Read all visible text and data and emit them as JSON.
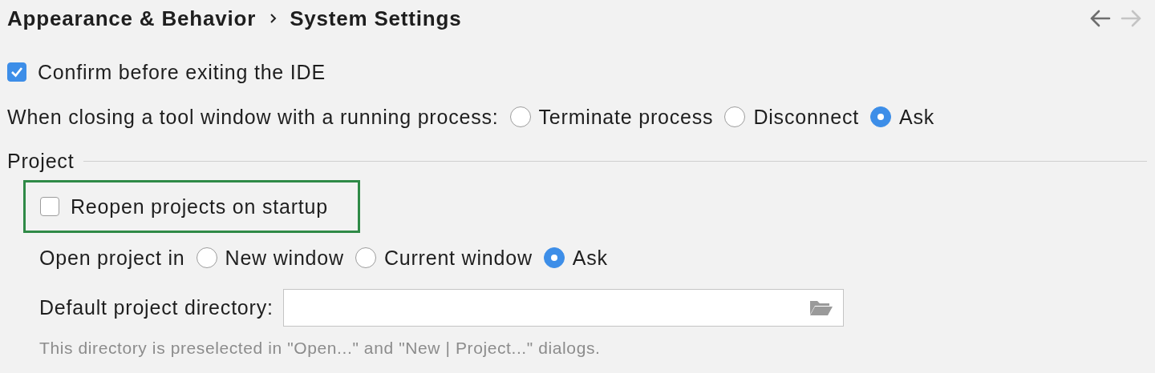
{
  "breadcrumb": [
    {
      "label": "Appearance & Behavior"
    },
    {
      "label": "System Settings"
    }
  ],
  "navigation": [
    {
      "kind": "back",
      "disabled": false
    },
    {
      "kind": "forward",
      "disabled": true
    }
  ],
  "confirm_exit": {
    "label": "Confirm before exiting the IDE",
    "checked": true
  },
  "closing_tool_window": {
    "label": "When closing a tool window with a running process:",
    "options": [
      {
        "label": "Terminate process",
        "selected": false
      },
      {
        "label": "Disconnect",
        "selected": false
      },
      {
        "label": "Ask",
        "selected": true
      }
    ]
  },
  "project": {
    "title": "Project",
    "reopen": {
      "label": "Reopen projects on startup",
      "checked": false,
      "highlighted": true
    },
    "open_in": {
      "label": "Open project in",
      "options": [
        {
          "label": "New window",
          "selected": false
        },
        {
          "label": "Current window",
          "selected": false
        },
        {
          "label": "Ask",
          "selected": true
        }
      ]
    },
    "directory": {
      "label": "Default project directory:",
      "hint": "This directory is preselected in \"Open...\" and \"New | Project...\" dialogs."
    }
  }
}
